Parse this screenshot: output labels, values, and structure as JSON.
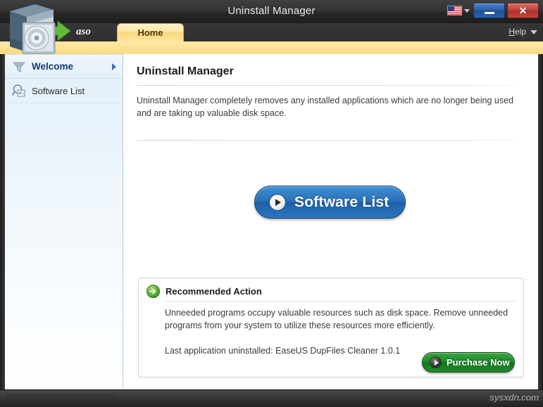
{
  "window": {
    "title": "Uninstall Manager",
    "minimize_label": "–",
    "close_label": "✕",
    "language_icon": "us-flag-icon"
  },
  "header": {
    "brand": "aso",
    "tabs": [
      {
        "label": "Home",
        "selected": true
      }
    ],
    "help_label_prefix": "H",
    "help_label_rest": "elp",
    "product_icon": "software-box-cd-icon"
  },
  "sidebar": {
    "items": [
      {
        "label": "Welcome",
        "icon": "funnel-icon",
        "selected": true,
        "has_caret": true
      },
      {
        "label": "Software List",
        "icon": "magnifier-list-icon",
        "selected": false,
        "has_caret": false
      }
    ]
  },
  "main": {
    "page_title": "Uninstall Manager",
    "intro": "Uninstall Manager completely removes any installed applications which are no longer being used and are taking up valuable disk space.",
    "primary_button": {
      "label": "Software List",
      "icon": "play-circle-icon"
    },
    "recommended": {
      "title": "Recommended Action",
      "icon": "green-arrow-circle-icon",
      "body": "Unneeded programs occupy valuable resources such as disk space. Remove unneeded programs from your system to utilize these resources more efficiently.",
      "last_uninstalled": "Last application uninstalled:  EaseUS DupFiles Cleaner 1.0.1",
      "purchase_button": {
        "label": "Purchase Now",
        "icon": "play-circle-icon"
      }
    }
  },
  "statusbar": {
    "watermark": "sysxdn.com"
  },
  "colors": {
    "accent_blue": "#2a72bb",
    "accent_green": "#1c8a2a",
    "tab_yellow": "#fde093",
    "sidebar_blue": "#e3f0f9",
    "title_dark": "#343434"
  }
}
